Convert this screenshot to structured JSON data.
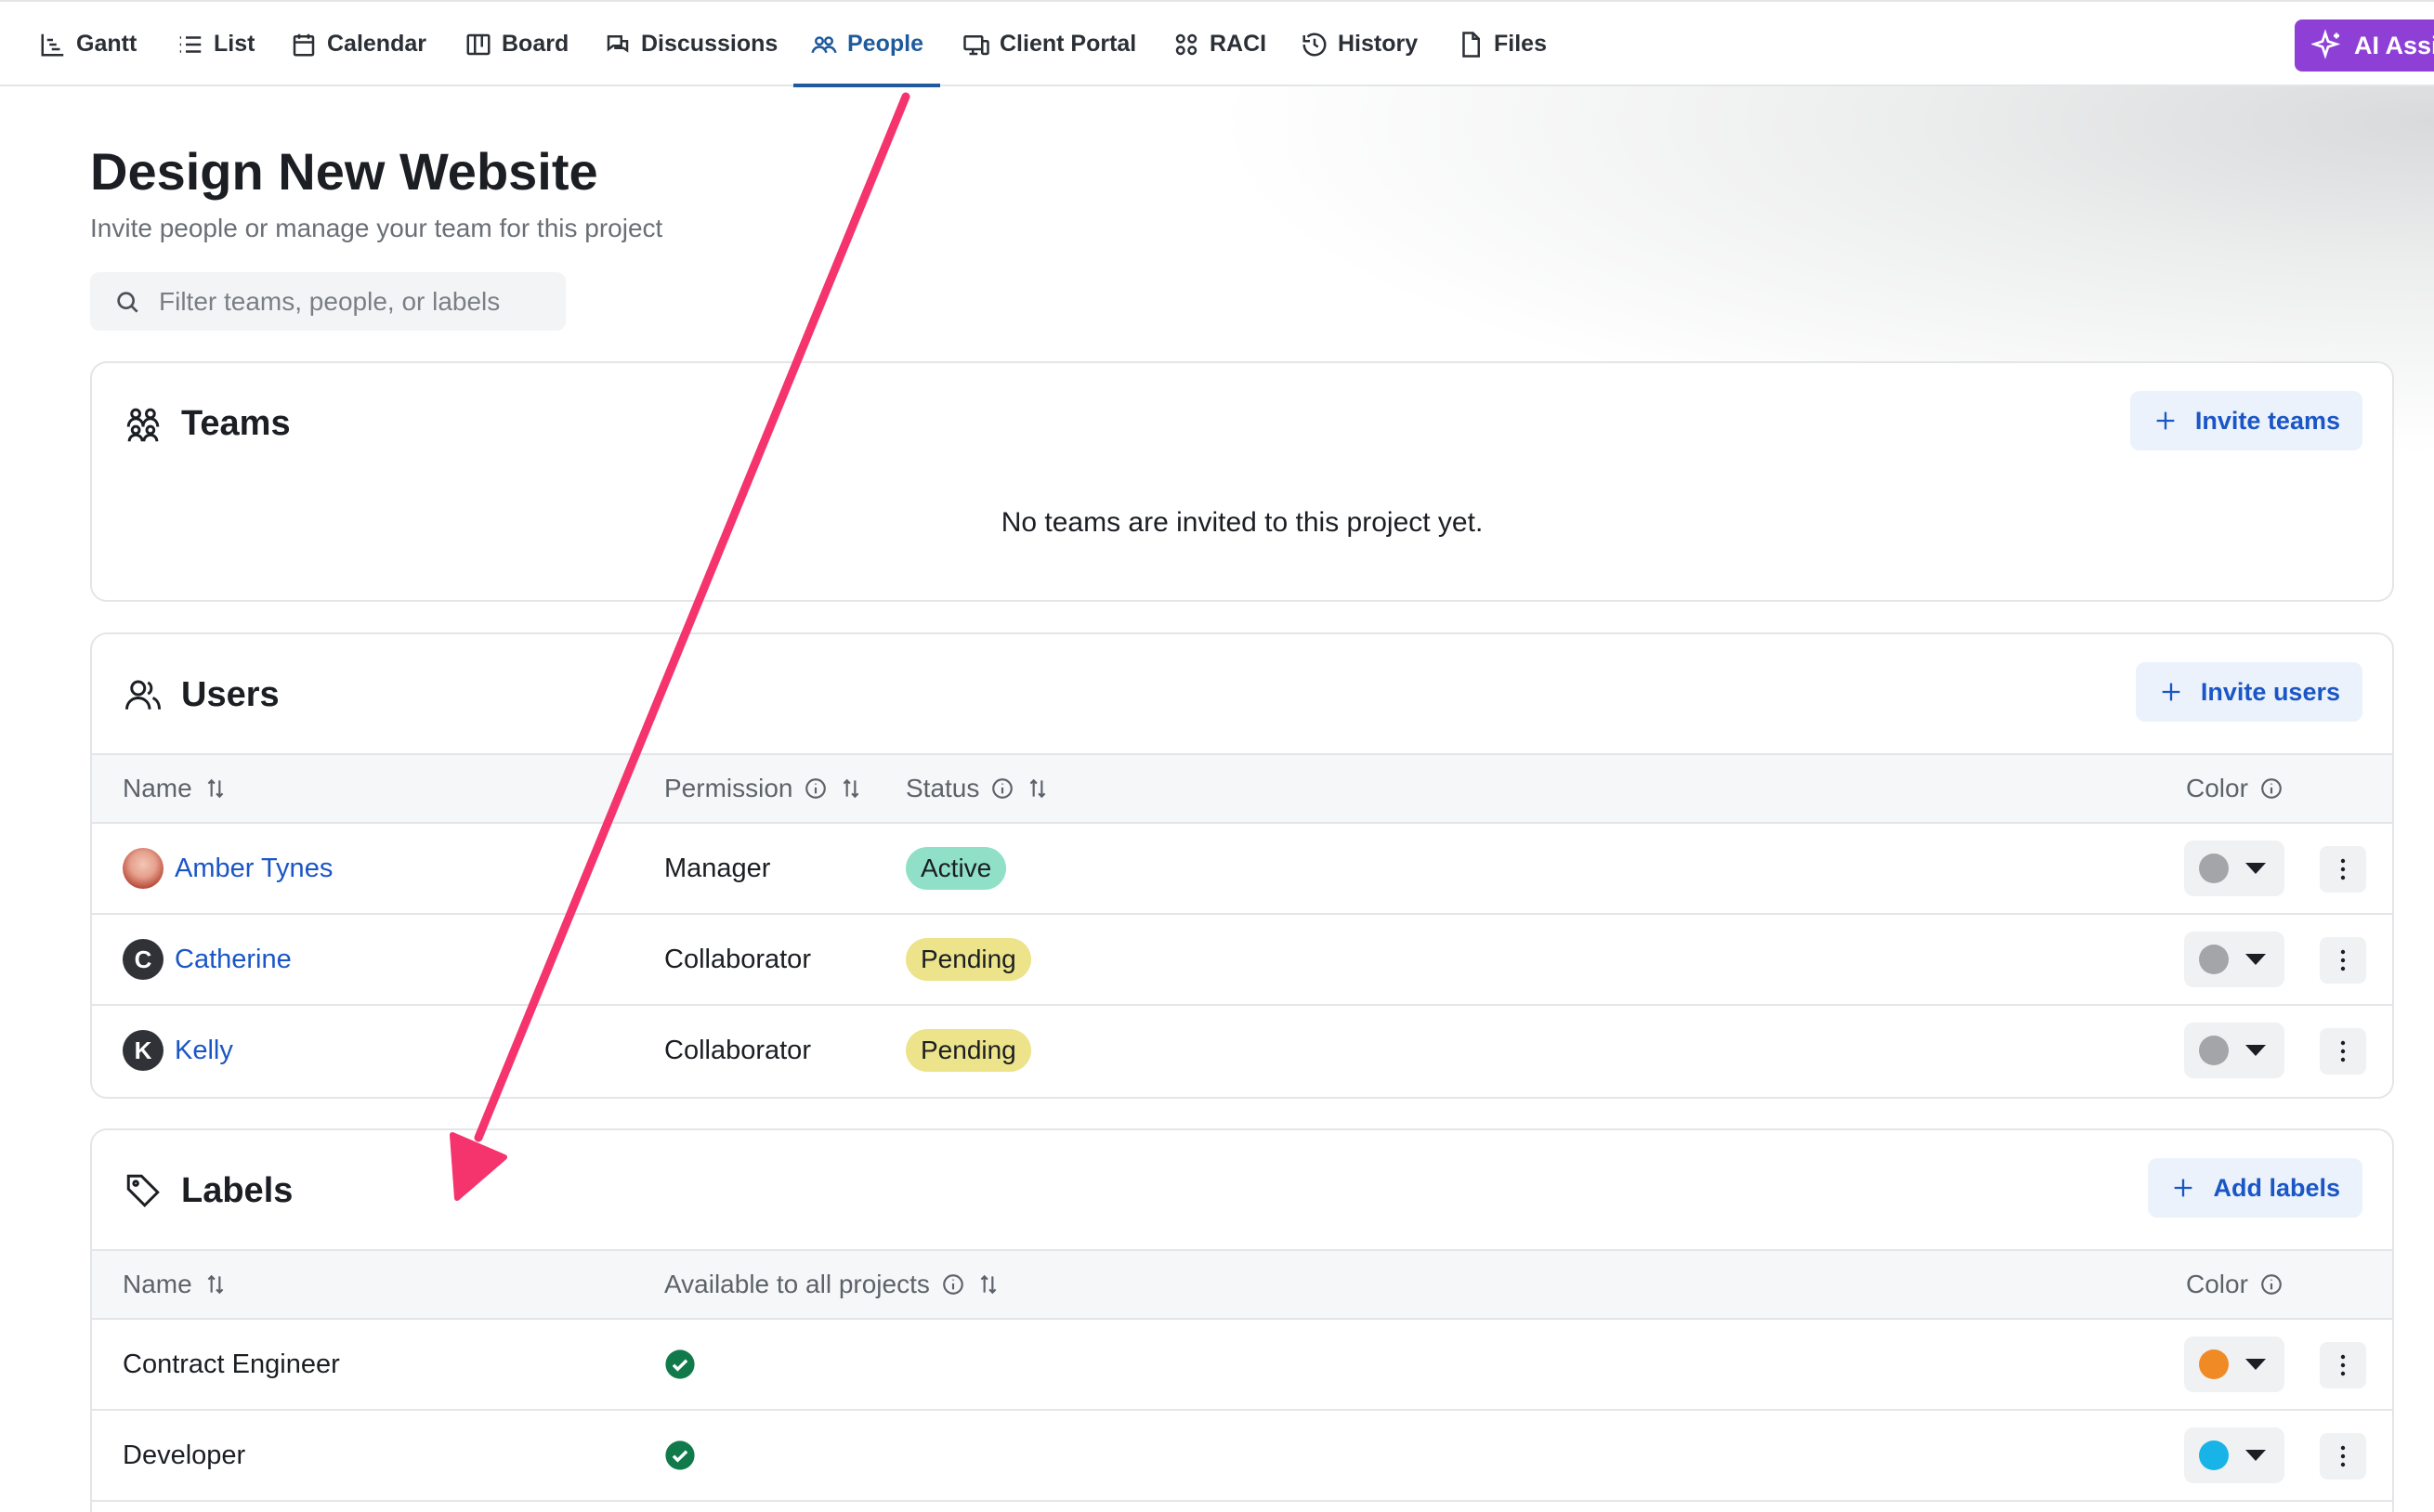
{
  "nav": {
    "tabs": [
      {
        "label": "Gantt",
        "icon": "gantt-icon"
      },
      {
        "label": "List",
        "icon": "list-icon"
      },
      {
        "label": "Calendar",
        "icon": "calendar-icon"
      },
      {
        "label": "Board",
        "icon": "board-icon"
      },
      {
        "label": "Discussions",
        "icon": "discussions-icon"
      },
      {
        "label": "People",
        "icon": "people-icon",
        "active": true
      },
      {
        "label": "Client Portal",
        "icon": "client-portal-icon"
      },
      {
        "label": "RACI",
        "icon": "raci-icon"
      },
      {
        "label": "History",
        "icon": "history-icon"
      },
      {
        "label": "Files",
        "icon": "file-icon"
      }
    ],
    "ai_button": "AI Assi",
    "active_color": "#1e5a9c",
    "ai_color": "#8e3fd6"
  },
  "page": {
    "title": "Design New Website",
    "subtitle": "Invite people or manage your team for this project"
  },
  "search": {
    "placeholder": "Filter teams, people, or labels",
    "value": ""
  },
  "teams": {
    "title": "Teams",
    "invite_label": "Invite teams",
    "empty_message": "No teams are invited to this project yet."
  },
  "users": {
    "title": "Users",
    "invite_label": "Invite users",
    "columns": {
      "name": "Name",
      "permission": "Permission",
      "status": "Status",
      "color": "Color"
    },
    "rows": [
      {
        "name": "Amber Tynes",
        "avatar": "photo",
        "permission": "Manager",
        "status": "Active",
        "status_type": "active",
        "color": "#a3a5a8"
      },
      {
        "name": "Catherine",
        "avatar": "C",
        "permission": "Collaborator",
        "status": "Pending",
        "status_type": "pending",
        "color": "#a3a5a8"
      },
      {
        "name": "Kelly",
        "avatar": "K",
        "permission": "Collaborator",
        "status": "Pending",
        "status_type": "pending",
        "color": "#a3a5a8"
      }
    ]
  },
  "labels": {
    "title": "Labels",
    "add_label": "Add labels",
    "columns": {
      "name": "Name",
      "available": "Available to all projects",
      "color": "Color"
    },
    "rows": [
      {
        "name": "Contract Engineer",
        "available": true,
        "color": "#f08a24"
      },
      {
        "name": "Developer",
        "available": true,
        "color": "#18b4e8"
      }
    ]
  },
  "annotation": {
    "arrow_color": "#f5346e"
  }
}
